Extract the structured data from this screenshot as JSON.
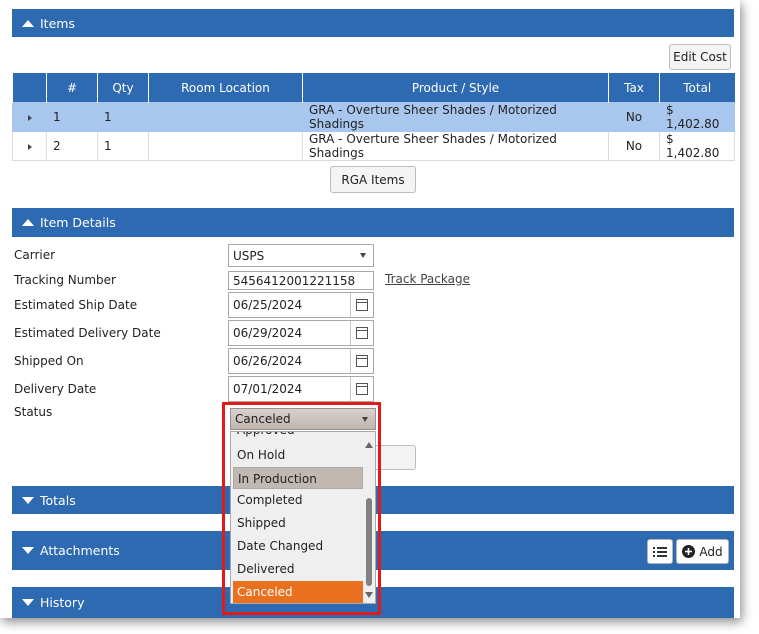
{
  "sections": {
    "items": "Items",
    "item_details": "Item Details",
    "totals": "Totals",
    "attachments": "Attachments",
    "history": "History"
  },
  "buttons": {
    "edit_cost": "Edit Cost",
    "rga_items": "RGA Items",
    "add": "Add"
  },
  "table": {
    "headers": [
      "",
      "#",
      "Qty",
      "Room Location",
      "Product / Style",
      "Tax",
      "Total"
    ],
    "rows": [
      {
        "num": "1",
        "qty": "1",
        "room": "",
        "product": "GRA - Overture Sheer Shades / Motorized Shadings",
        "tax": "No",
        "total": "$ 1,402.80"
      },
      {
        "num": "2",
        "qty": "1",
        "room": "",
        "product": "GRA - Overture Sheer Shades / Motorized Shadings",
        "tax": "No",
        "total": "$ 1,402.80"
      }
    ]
  },
  "details": {
    "carrier_label": "Carrier",
    "carrier_value": "USPS",
    "tracking_label": "Tracking Number",
    "tracking_value": "5456412001221158",
    "track_link": "Track Package",
    "est_ship_label": "Estimated Ship Date",
    "est_ship_value": "06/25/2024",
    "est_delivery_label": "Estimated Delivery Date",
    "est_delivery_value": "06/29/2024",
    "shipped_on_label": "Shipped On",
    "shipped_on_value": "06/26/2024",
    "delivery_label": "Delivery Date",
    "delivery_value": "07/01/2024",
    "status_label": "Status",
    "status_value": "Canceled"
  },
  "status_options": [
    "Approved",
    "On Hold",
    "In Production",
    "Completed",
    "Shipped",
    "Date Changed",
    "Delivered",
    "Canceled"
  ],
  "colors": {
    "section_bar": "#2e6ab1",
    "selected_row": "#a9c7ee",
    "highlight_box": "#e01b1b",
    "selected_option": "#e8701e"
  },
  "icons": [
    "caret-up-icon",
    "caret-down-icon",
    "caret-right-icon",
    "calendar-icon",
    "list-icon",
    "plus-circle-icon"
  ]
}
